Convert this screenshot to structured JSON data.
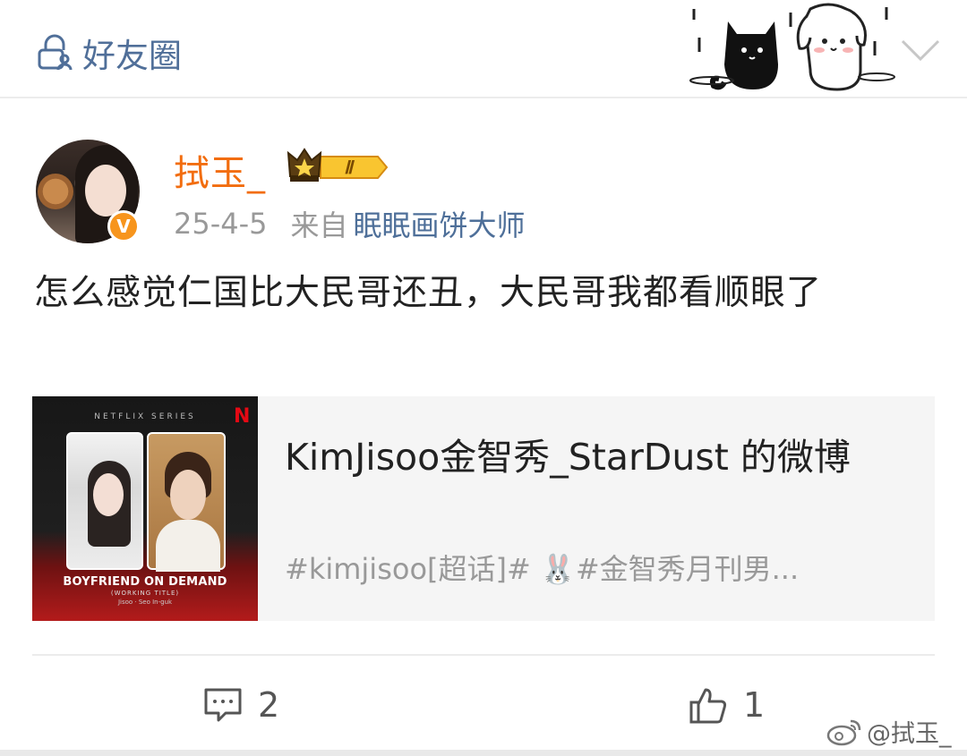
{
  "header": {
    "visibility_label": "好友圈",
    "icons": [
      "lock-people-icon",
      "chevron-down-icon"
    ]
  },
  "post": {
    "username": "拭玉_",
    "vip_level": "Ⅱ",
    "date": "25-4-5",
    "source_prefix": "来自",
    "source_app": "眠眠画饼大师",
    "verified_mark": "V",
    "text": "怎么感觉仁国比大民哥还丑，大民哥我都看顺眼了"
  },
  "link_card": {
    "thumbnail": {
      "series_label": "NETFLIX SERIES",
      "netflix_mark": "N",
      "show_title": "BOYFRIEND ON DEMAND",
      "working_title": "(WORKING TITLE)",
      "cast": "Jisoo · Seo In-guk"
    },
    "title": "KimJisoo金智秀_StarDust 的微博",
    "description": "#kimjisoo[超话]#  🐰#金智秀月刊男..."
  },
  "actions": {
    "comment_count": "2",
    "like_count": "1"
  },
  "watermark": {
    "text": "@拭玉_"
  },
  "colors": {
    "username": "#f26d0f",
    "link_blue": "#4e6f99",
    "verified_orange": "#f7951d",
    "secondary_text": "#999999"
  }
}
